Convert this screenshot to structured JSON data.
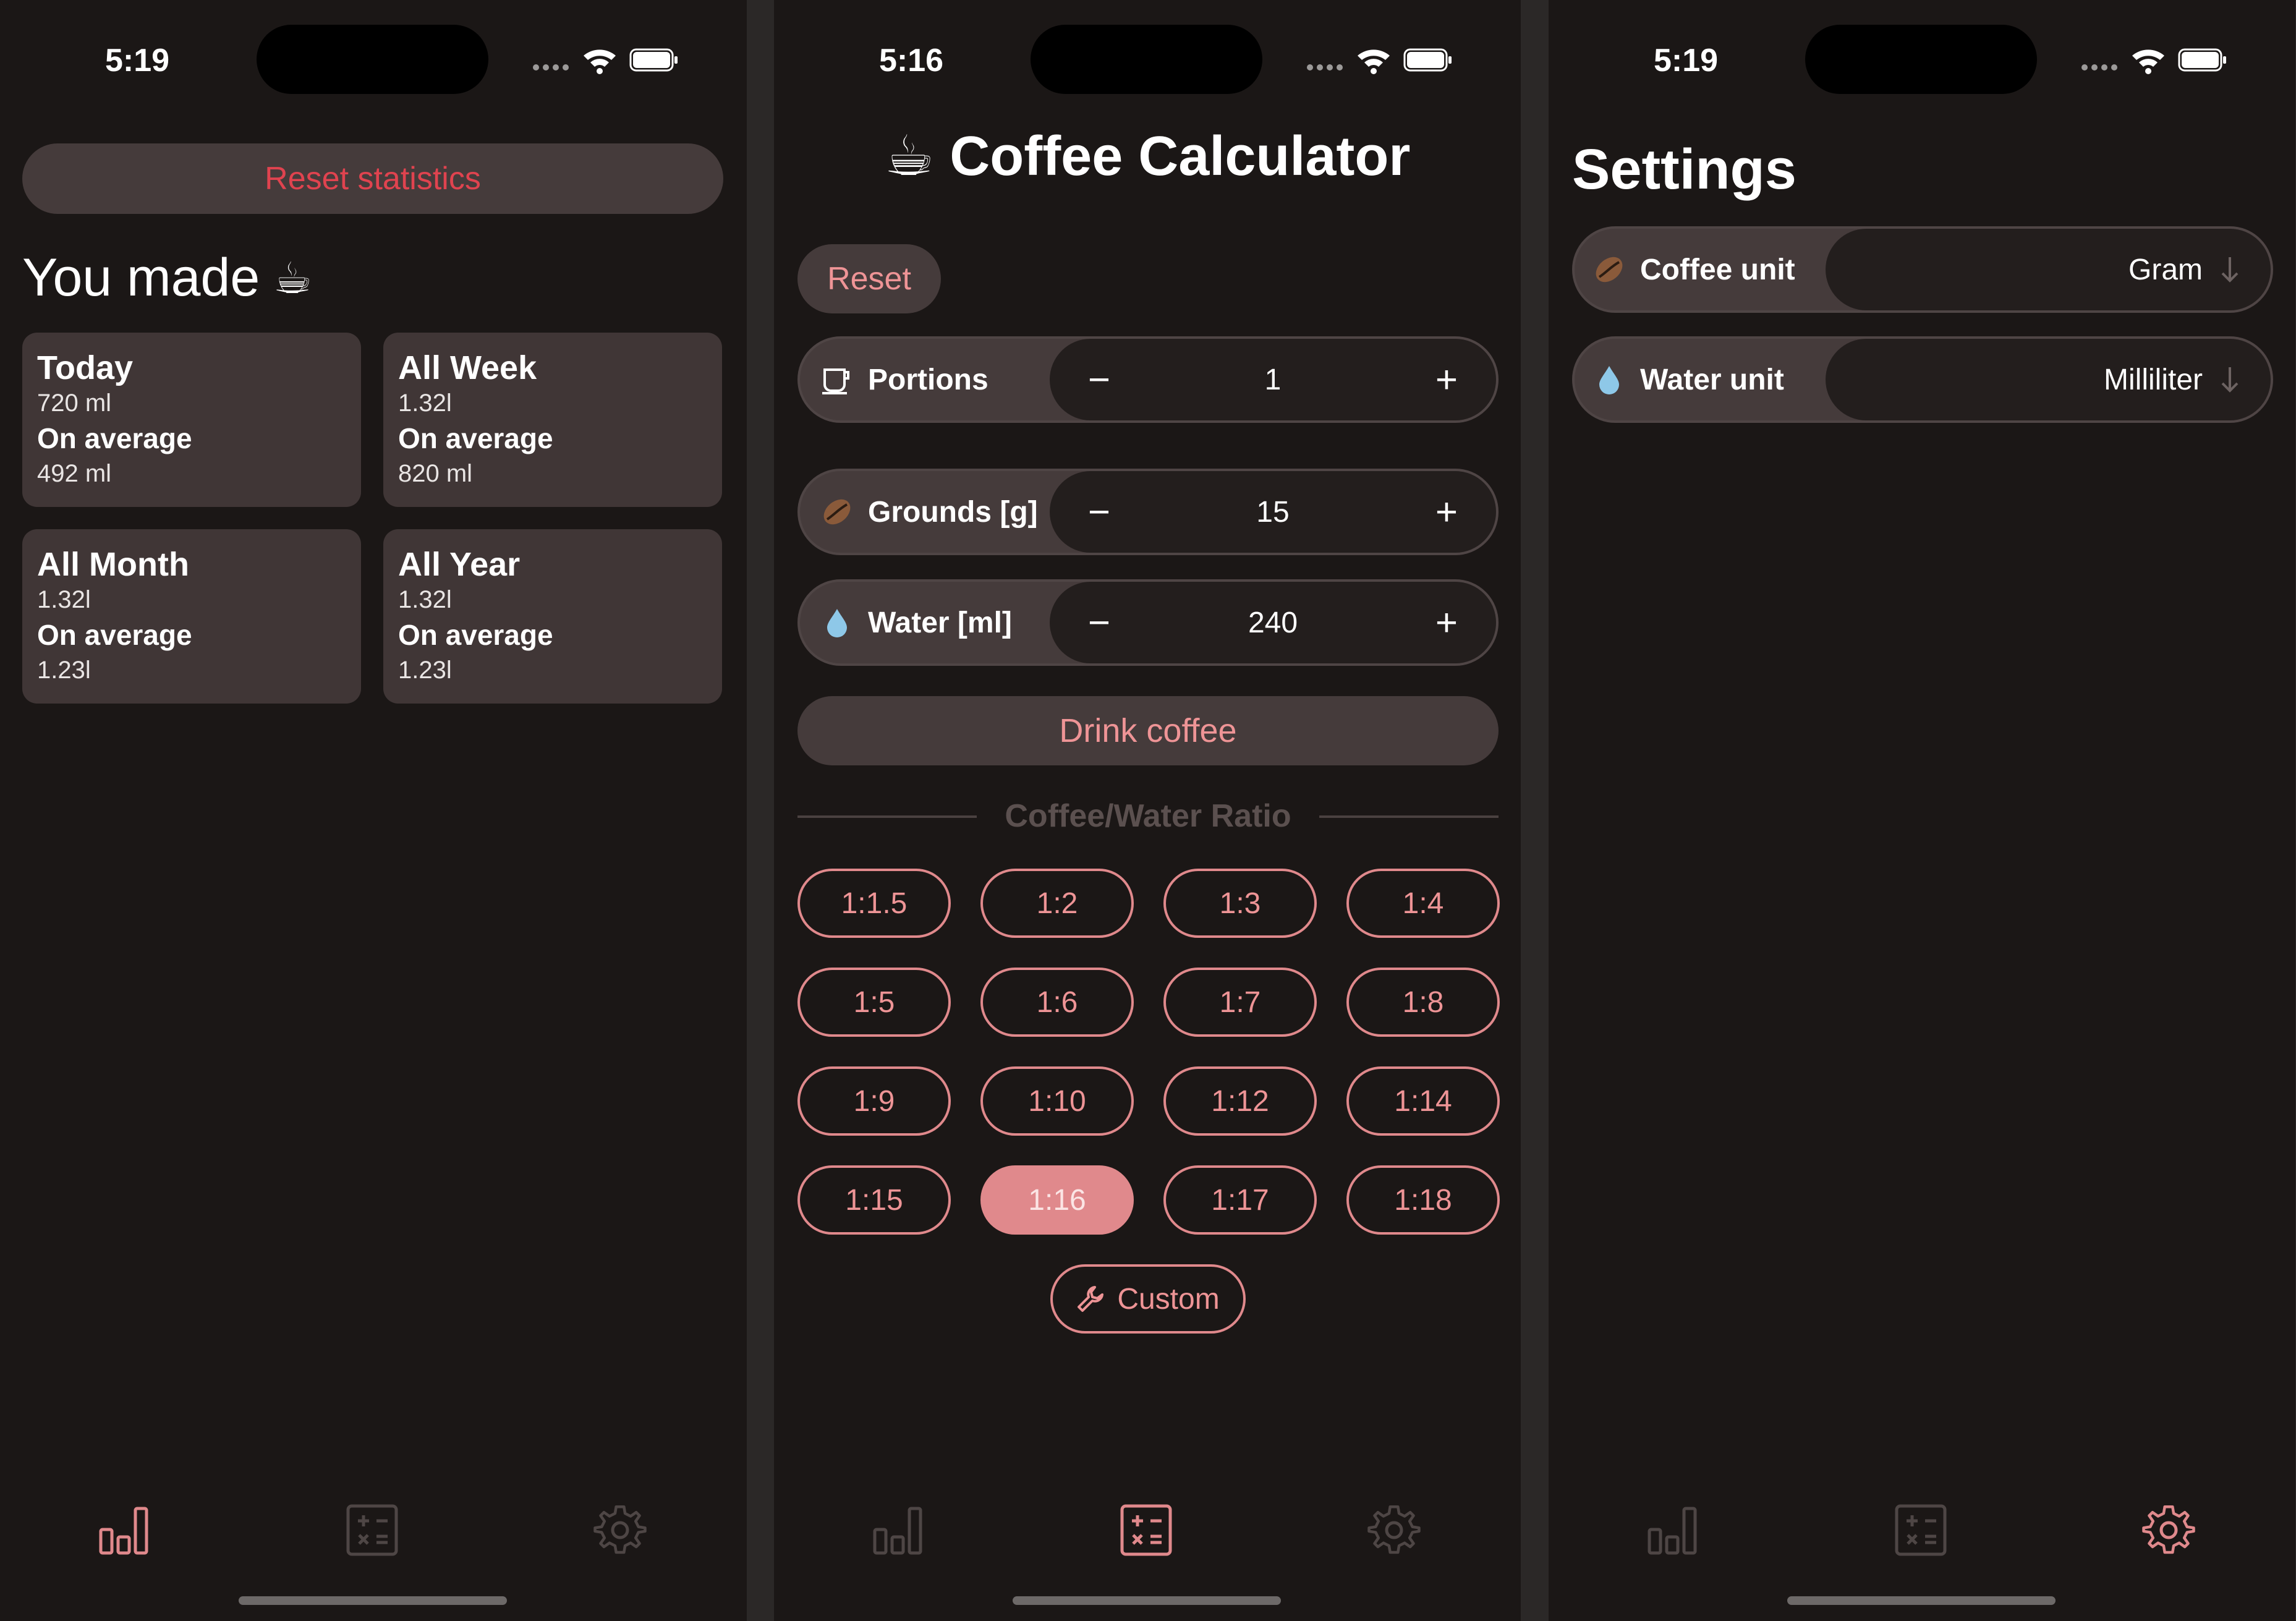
{
  "status": {
    "stats_time": "5:19",
    "calc_time": "5:16",
    "settings_time": "5:19"
  },
  "stats": {
    "reset_label": "Reset statistics",
    "heading": "You made",
    "heading_emoji": "☕",
    "cards": [
      {
        "title": "Today",
        "total": "720 ml",
        "avg_label": "On average",
        "avg": "492 ml"
      },
      {
        "title": "All Week",
        "total": "1.32l",
        "avg_label": "On average",
        "avg": "820 ml"
      },
      {
        "title": "All Month",
        "total": "1.32l",
        "avg_label": "On average",
        "avg": "1.23l"
      },
      {
        "title": "All Year",
        "total": "1.32l",
        "avg_label": "On average",
        "avg": "1.23l"
      }
    ]
  },
  "calculator": {
    "title": "☕ Coffee Calculator",
    "reset_label": "Reset",
    "portions": {
      "label": "Portions",
      "value": "1",
      "minus": "−",
      "plus": "+"
    },
    "grounds": {
      "label": "Grounds [g]",
      "value": "15",
      "minus": "−",
      "plus": "+"
    },
    "water": {
      "label": "Water [ml]",
      "value": "240",
      "minus": "−",
      "plus": "+"
    },
    "drink_label": "Drink coffee",
    "ratio_heading": "Coffee/Water Ratio",
    "ratios": [
      "1:1.5",
      "1:2",
      "1:3",
      "1:4",
      "1:5",
      "1:6",
      "1:7",
      "1:8",
      "1:9",
      "1:10",
      "1:12",
      "1:14",
      "1:15",
      "1:16",
      "1:17",
      "1:18"
    ],
    "selected_ratio": "1:16",
    "custom_label": "Custom"
  },
  "settings": {
    "title": "Settings",
    "coffee_unit": {
      "label": "Coffee unit",
      "value": "Gram"
    },
    "water_unit": {
      "label": "Water unit",
      "value": "Milliliter"
    }
  },
  "colors": {
    "background": "#1b1716",
    "card": "#403636",
    "accent": "#e0898c",
    "danger": "#e0434f",
    "muted": "#5b504f",
    "water_drop": "#8ec8e8",
    "coffee_bean": "#8a5a3a"
  },
  "icons": {
    "tabs": [
      "bar-chart-icon",
      "calculator-icon",
      "gear-icon"
    ],
    "portions": "cup-icon",
    "grounds": "coffee-bean-icon",
    "water": "water-drop-icon",
    "custom": "wrench-icon"
  }
}
